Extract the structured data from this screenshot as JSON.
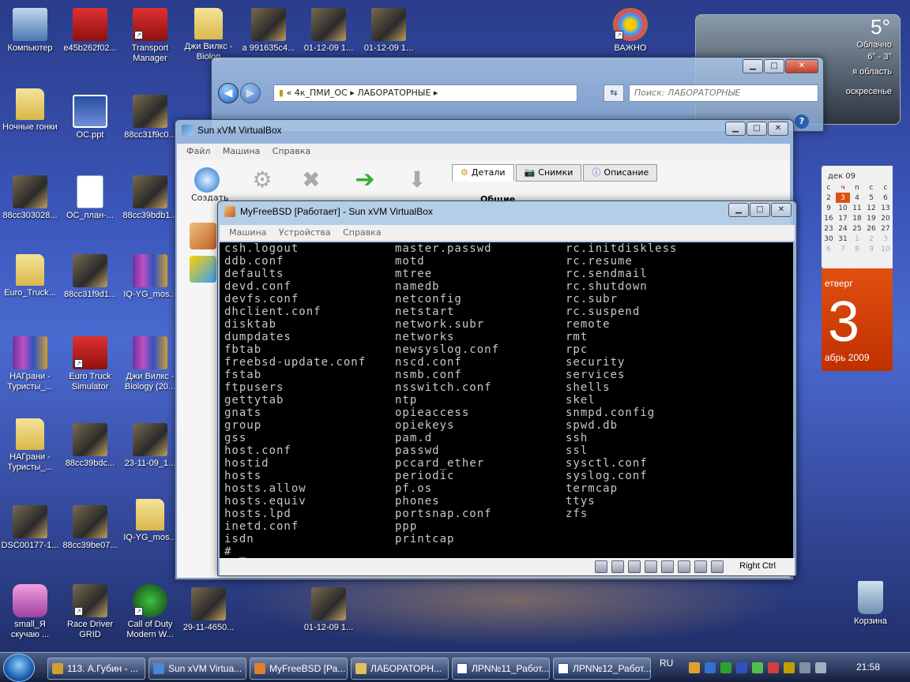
{
  "desktop_icons": [
    {
      "label": "Компьютер",
      "kind": "pc"
    },
    {
      "label": "e45b262f02...",
      "kind": "red"
    },
    {
      "label": "Transport Manager",
      "kind": "red"
    },
    {
      "label": "Джи Вилкс - Biolog",
      "kind": "folder"
    },
    {
      "label": "a 991635c4...",
      "kind": "photo"
    },
    {
      "label": "01-12-09 1...",
      "kind": "photo"
    },
    {
      "label": "01-12-09 1...",
      "kind": "photo"
    },
    {
      "label": "ВАЖНО",
      "kind": "star"
    },
    {
      "label": "Ночные гонки",
      "kind": "folder"
    },
    {
      "label": "ОС.ppt",
      "kind": "ppt"
    },
    {
      "label": "88cc31f9c0...",
      "kind": "photo"
    },
    {
      "label": "88cc303028...",
      "kind": "photo"
    },
    {
      "label": "ОС_план-...",
      "kind": "doc"
    },
    {
      "label": "88cc39bdb1...",
      "kind": "photo"
    },
    {
      "label": "Euro_Truck...",
      "kind": "folder"
    },
    {
      "label": "88cc31f9d1...",
      "kind": "photo"
    },
    {
      "label": "IQ-YG_mos...",
      "kind": "rar"
    },
    {
      "label": "НАГрани - Туристы_...",
      "kind": "rar"
    },
    {
      "label": "Euro Truck Simulator",
      "kind": "red"
    },
    {
      "label": "Джи Вилкс - Biology (20...",
      "kind": "rar"
    },
    {
      "label": "НАГрани - Туристы_...",
      "kind": "folder"
    },
    {
      "label": "88cc39bdc...",
      "kind": "photo"
    },
    {
      "label": "23-11-09_1...",
      "kind": "photo"
    },
    {
      "label": "DSC00177-1...",
      "kind": "photo"
    },
    {
      "label": "88cc39be07...",
      "kind": "photo"
    },
    {
      "label": "IQ-YG_mos...",
      "kind": "folder"
    },
    {
      "label": "small_Я скучаю ...",
      "kind": "pink"
    },
    {
      "label": "Race Driver GRID",
      "kind": "photo"
    },
    {
      "label": "Call of Duty Modern W...",
      "kind": "game"
    },
    {
      "label": "29-11-4650...",
      "kind": "photo"
    },
    {
      "label": "01-12-09 1...",
      "kind": "photo"
    },
    {
      "label": "Корзина",
      "kind": "bin"
    }
  ],
  "weather": {
    "temp": "5°",
    "condition": "Облачно",
    "range": "6° - 3°",
    "region": "я область",
    "day": "оскресенье"
  },
  "calendar": {
    "month": "дек 09",
    "headers": [
      "с",
      "ч",
      "п",
      "с",
      "с"
    ],
    "rows": [
      [
        "2",
        "3",
        "4",
        "5",
        "6"
      ],
      [
        "9",
        "10",
        "11",
        "12",
        "13"
      ],
      [
        "16",
        "17",
        "18",
        "19",
        "20"
      ],
      [
        "23",
        "24",
        "25",
        "26",
        "27"
      ],
      [
        "30",
        "31",
        "1",
        "2",
        "3"
      ],
      [
        "6",
        "7",
        "8",
        "9",
        "10"
      ]
    ]
  },
  "day_gadget": {
    "weekday": "етверг",
    "day": "3",
    "month": "абрь 2009"
  },
  "explorer": {
    "path_1": "4к_ПМИ_ОС",
    "path_2": "ЛАБОРАТОРНЫЕ",
    "search_placeholder": "Поиск: ЛАБОРАТОРНЫЕ"
  },
  "vbox_manager": {
    "title": "Sun xVM VirtualBox",
    "menu": [
      "Файл",
      "Машина",
      "Справка"
    ],
    "toolbar_create": "Создать",
    "tabs": [
      "Детали",
      "Снимки",
      "Описание"
    ],
    "section": "Общие"
  },
  "vm_window": {
    "title": "MyFreeBSD [Работает] - Sun xVM VirtualBox",
    "menu": [
      "Машина",
      "Устройства",
      "Справка"
    ],
    "host_key": "Right Ctrl",
    "console_col1": "csh.logout\nddb.conf\ndefaults\ndevd.conf\ndevfs.conf\ndhclient.conf\ndisktab\ndumpdates\nfbtab\nfreebsd-update.conf\nfstab\nftpusers\ngettytab\ngnats\ngroup\ngss\nhost.conf\nhostid\nhosts\nhosts.allow\nhosts.equiv\nhosts.lpd\ninetd.conf\nisdn\n# _",
    "console_col2": "master.passwd\nmotd\nmtree\nnamedb\nnetconfig\nnetstart\nnetwork.subr\nnetworks\nnewsyslog.conf\nnscd.conf\nnsmb.conf\nnsswitch.conf\nntp\nopieaccess\nopiekeys\npam.d\npasswd\npccard_ether\nperiodic\npf.os\nphones\nportsnap.conf\nppp\nprintcap",
    "console_col3": "rc.initdiskless\nrc.resume\nrc.sendmail\nrc.shutdown\nrc.subr\nrc.suspend\nremote\nrmt\nrpc\nsecurity\nservices\nshells\nskel\nsnmpd.config\nspwd.db\nssh\nssl\nsysctl.conf\nsyslog.conf\ntermcap\nttys\nzfs"
  },
  "taskbar": {
    "tasks": [
      "113. А.Губин - ...",
      "Sun xVM Virtua...",
      "MyFreeBSD [Ра...",
      "ЛАБОРАТОРН...",
      "ЛРN№11_Работ...",
      "ЛРN№12_Работ..."
    ],
    "lang": "RU",
    "time": "21:58"
  }
}
